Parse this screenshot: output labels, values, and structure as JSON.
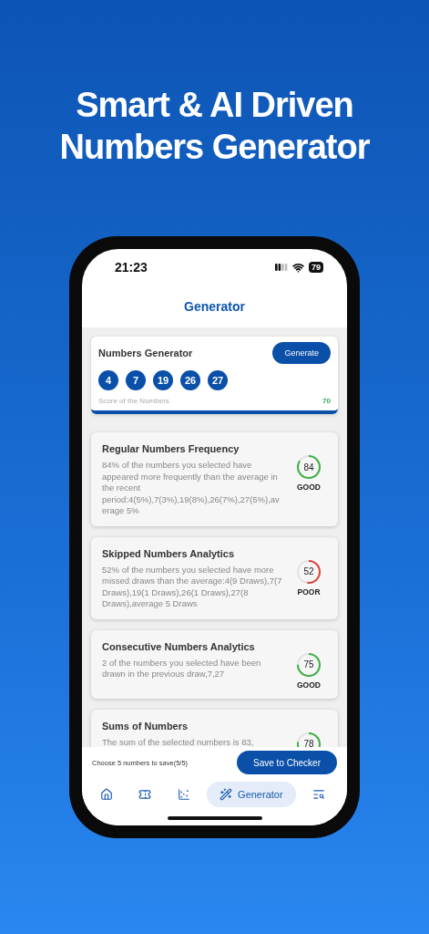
{
  "headline": [
    "Smart & AI Driven",
    "Numbers Generator"
  ],
  "status_bar": {
    "time": "21:23",
    "battery": "79"
  },
  "header": {
    "title": "Generator"
  },
  "generator": {
    "title": "Numbers Generator",
    "button": "Generate",
    "numbers": [
      "4",
      "7",
      "19",
      "26",
      "27"
    ],
    "score_label": "Score of the Numbers",
    "score": "70"
  },
  "analytics": [
    {
      "title": "Regular Numbers Frequency",
      "text": "84% of the numbers you selected have appeared more frequently than the average in the recent period:4(5%),7(3%),19(8%),26(7%),27(5%),average 5%",
      "score": "84",
      "rating": "GOOD",
      "color": "#3cb043"
    },
    {
      "title": "Skipped Numbers Analytics",
      "text": "52% of the numbers you selected have more missed draws than the average:4(9 Draws),7(7 Draws),19(1 Draws),26(1 Draws),27(8 Draws),average 5 Draws",
      "score": "52",
      "rating": "POOR",
      "color": "#e0443a"
    },
    {
      "title": "Consecutive Numbers Analytics",
      "text": "2 of the numbers you selected have been drawn in the previous draw,7,27",
      "score": "75",
      "rating": "GOOD",
      "color": "#3cb043"
    },
    {
      "title": "Sums of Numbers",
      "text": "The sum of the selected numbers is 83,",
      "score": "78",
      "color": "#3cb043"
    }
  ],
  "save_bar": {
    "hint": "Choose 5 numbers to save(5/5)",
    "button": "Save to Checker"
  },
  "nav": [
    {
      "kind": "home",
      "selected": false
    },
    {
      "kind": "ticket",
      "selected": false
    },
    {
      "kind": "chart",
      "selected": false
    },
    {
      "kind": "wand",
      "label": "Generator",
      "selected": true
    },
    {
      "kind": "search",
      "selected": false
    }
  ]
}
